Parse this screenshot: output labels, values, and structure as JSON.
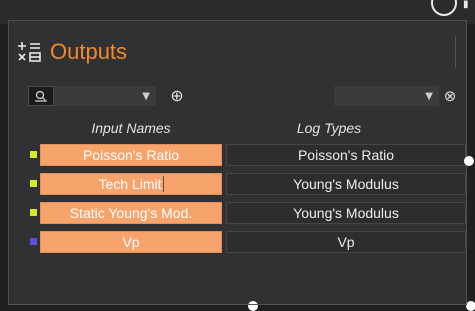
{
  "panel": {
    "title": "Outputs",
    "title_color": "#f08a2c",
    "title_icon": "outputs-grid-icon"
  },
  "toolbar": {
    "left_combo_value": "",
    "left_combo_icon": "tool-select-icon",
    "add_icon": "add-circle-icon",
    "right_combo_value": "",
    "remove_icon": "remove-circle-icon"
  },
  "columns": {
    "input_names": "Input Names",
    "log_types": "Log Types"
  },
  "rows": [
    {
      "name": "Poisson's Ratio",
      "type": "Poisson's Ratio",
      "marker_color": "#d8e82a"
    },
    {
      "name": "Tech Limit",
      "type": "Young's Modulus",
      "marker_color": "#d8e82a"
    },
    {
      "name": "Static Young's Mod.",
      "type": "Young's Modulus",
      "marker_color": "#d8e82a"
    },
    {
      "name": "Vp",
      "type": "Vp",
      "marker_color": "#5b4ee0"
    }
  ],
  "colors": {
    "name_cell_bg": "#f7a36c",
    "panel_bg": "#303132"
  }
}
